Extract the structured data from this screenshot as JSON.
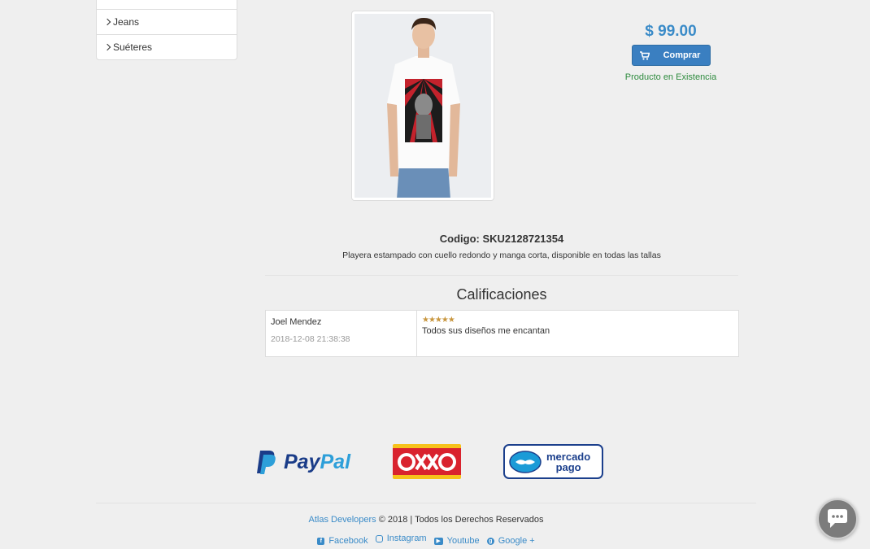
{
  "sidebar": {
    "items": [
      {
        "label": ""
      },
      {
        "label": "Jeans"
      },
      {
        "label": "Suéteres"
      }
    ]
  },
  "product": {
    "price": "$ 99.00",
    "buy_label": "Comprar",
    "stock": "Producto en Existencia",
    "sku": "Codigo: SKU2128721354",
    "description": "Playera estampado con cuello redondo y manga corta, disponible en todas las tallas"
  },
  "ratings": {
    "title": "Calificaciones",
    "reviews": [
      {
        "name": "Joel Mendez",
        "date": "2018-12-08 21:38:38",
        "stars": "★★★★★",
        "comment": "Todos sus diseños me encantan"
      }
    ]
  },
  "payments": {
    "paypal": "PayPal",
    "oxxo": "OXXO",
    "mercadopago_line1": "mercado",
    "mercadopago_line2": "pago"
  },
  "footer": {
    "brand": "Atlas Developers",
    "rights": " © 2018 | Todos los Derechos Reservados",
    "links": [
      {
        "label": "Facebook",
        "icon": "facebook-icon"
      },
      {
        "label": "Instagram",
        "icon": "instagram-icon"
      },
      {
        "label": "Youtube",
        "icon": "youtube-icon"
      },
      {
        "label": "Google +",
        "icon": "google-plus-icon"
      }
    ]
  },
  "colors": {
    "accent": "#3a8bc8",
    "button": "#3a7fc1",
    "stock": "#2e8b3e",
    "stars": "#c8963e"
  }
}
